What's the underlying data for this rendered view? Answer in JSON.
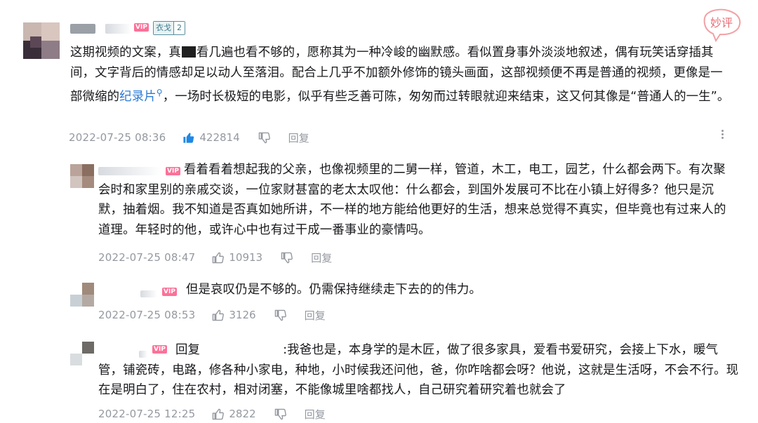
{
  "watermark": {
    "label": "妙评"
  },
  "main_comment": {
    "fan_badge": {
      "name": "衣戈",
      "level": "2"
    },
    "text_a": "这期视频的文案，真",
    "text_b": "看几遍也看不够的，愿称其为一种冷峻的幽默感。看似置身事外淡淡地叙述，偶有玩笑话穿插其间，文字背后的情感却足以动人至落泪。配合上几乎不加额外修饰的镜头画面，这部视频便不再是普通的视频，更像是一部微缩的",
    "link": "纪录片",
    "text_c": "，一场时长极短的电影，似乎有些乏善可陈，匆匆而过转眼就迎来结束，这又何其像是“普通人的一生”。",
    "date": "2022-07-25 08:36",
    "likes": "422814",
    "reply_label": "回复"
  },
  "replies": [
    {
      "text": "看着看着想起我的父亲，也像视频里的二舅一样，管道，木工，电工，园艺，什么都会两下。有次聚会时和家里别的亲戚交谈，一位家财甚富的老太太叹他：什么都会，到国外发展可不比在小镇上好得多？他只是沉默，抽着烟。我不知道是否真如她所讲，不一样的地方能给他更好的生活，想来总觉得不真实，但毕竟也有过来人的道理。年轻时的他，或许心中也有过干成一番事业的豪情吗。",
      "date": "2022-07-25 08:47",
      "likes": "10913",
      "reply_label": "回复"
    },
    {
      "text": "但是哀叹仍是不够的。仍需保持继续走下去的的伟力。",
      "date": "2022-07-25 08:53",
      "likes": "3126",
      "reply_label": "回复"
    },
    {
      "reply_prefix": "回复",
      "text": ":我爸也是，本身学的是木匠，做了很多家具，爱看书爱研究，会接上下水，暖气管，铺瓷砖，电路，修各种小家电，种地，小时候我还问他，爸，你咋啥都会呀？他说，这就是生活呀，不会不行。现在是明白了，住在农村，相对闭塞，不能像城里啥都找人，自己研究着研究着也就会了",
      "date": "2022-07-25 12:25",
      "likes": "2822",
      "reply_label": "回复"
    }
  ],
  "vip_label": "VIP",
  "colors": {
    "link": "#2c7bd6",
    "meta": "#9499a0",
    "like_active": "#1e88e5",
    "vip": "#fb7299"
  }
}
